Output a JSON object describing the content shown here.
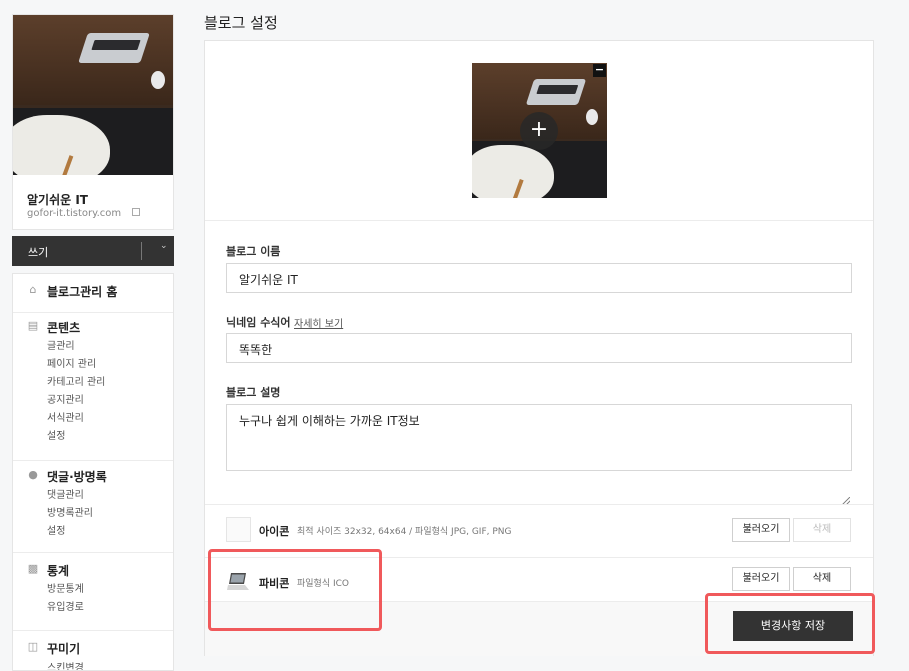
{
  "sidebar": {
    "blog_name": "알기쉬운 IT",
    "blog_url": "gofor-it.tistory.com",
    "write_label": "쓰기",
    "menu": [
      {
        "icon": "home-icon",
        "label": "블로그관리 홈",
        "items": []
      },
      {
        "icon": "document-icon",
        "label": "콘텐츠",
        "items": [
          "글관리",
          "페이지 관리",
          "카테고리 관리",
          "공지관리",
          "서식관리",
          "설정"
        ]
      },
      {
        "icon": "speech-bubble-icon",
        "label": "댓글·방명록",
        "items": [
          "댓글관리",
          "방명록관리",
          "설정"
        ]
      },
      {
        "icon": "bar-chart-icon",
        "label": "통계",
        "items": [
          "방문통계",
          "유입경로"
        ]
      },
      {
        "icon": "layout-icon",
        "label": "꾸미기",
        "items": [
          "스킨변경"
        ]
      }
    ]
  },
  "main": {
    "page_title": "블로그 설정",
    "fields": {
      "blog_name_label": "블로그 이름",
      "blog_name_value": "알기쉬운 IT",
      "nickname_label": "닉네임 수식어",
      "nickname_link": "자세히 보기",
      "nickname_value": "똑똑한",
      "description_label": "블로그 설명",
      "description_value": "누구나 쉽게 이해하는 가까운 IT정보"
    },
    "icon_row": {
      "title": "아이콘",
      "desc": "최적 사이즈 32x32, 64x64 / 파일형식 JPG, GIF, PNG",
      "load_label": "불러오기",
      "delete_label": "삭제"
    },
    "favicon_row": {
      "title": "파비콘",
      "desc": "파일형식 ICO",
      "load_label": "불러오기",
      "delete_label": "삭제"
    },
    "save_label": "변경사항 저장"
  },
  "colors": {
    "highlight": "#f0595b",
    "dark_button": "#333333"
  }
}
